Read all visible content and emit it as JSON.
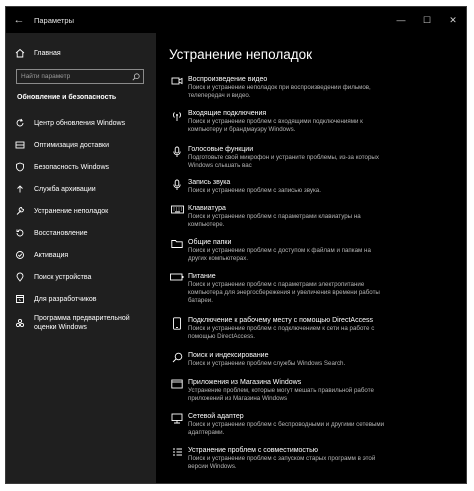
{
  "window": {
    "title": "Параметры",
    "back_icon": "←",
    "minimize_icon": "—",
    "maximize_icon": "☐",
    "close_icon": "✕"
  },
  "sidebar": {
    "home_label": "Главная",
    "search_placeholder": "Найти параметр",
    "section_label": "Обновление и безопасность",
    "items": [
      {
        "label": "Центр обновления Windows",
        "icon": "refresh-icon"
      },
      {
        "label": "Оптимизация доставки",
        "icon": "delivery-icon"
      },
      {
        "label": "Безопасность Windows",
        "icon": "shield-icon"
      },
      {
        "label": "Служба архивации",
        "icon": "backup-icon"
      },
      {
        "label": "Устранение неполадок",
        "icon": "wrench-icon"
      },
      {
        "label": "Восстановление",
        "icon": "recovery-icon"
      },
      {
        "label": "Активация",
        "icon": "activation-icon"
      },
      {
        "label": "Поиск устройства",
        "icon": "find-device-icon"
      },
      {
        "label": "Для разработчиков",
        "icon": "developer-icon"
      },
      {
        "label": "Программа предварительной оценки Windows",
        "icon": "insider-icon"
      }
    ]
  },
  "main": {
    "title": "Устранение неполадок",
    "items": [
      {
        "title": "Воспроизведение видео",
        "desc": "Поиск и устранение неполадок при воспроизведении фильмов, телепередач и видео.",
        "icon": "video-icon"
      },
      {
        "title": "Входящие подключения",
        "desc": "Поиск и устранение проблем с входящими подключениями к компьютеру и брандмауэру Windows.",
        "icon": "antenna-icon"
      },
      {
        "title": "Голосовые функции",
        "desc": "Подготовьте свой микрофон и устраните проблемы, из-за которых Windows слышать вас",
        "icon": "microphone-icon"
      },
      {
        "title": "Запись звука",
        "desc": "Поиск и устранение проблем с записью звука.",
        "icon": "microphone-icon"
      },
      {
        "title": "Клавиатура",
        "desc": "Поиск и устранение проблем с параметрами клавиатуры на компьютере.",
        "icon": "keyboard-icon"
      },
      {
        "title": "Общие папки",
        "desc": "Поиск и устранение проблем с доступом к файлам и папкам на других компьютерах.",
        "icon": "shared-folder-icon"
      },
      {
        "title": "Питание",
        "desc": "Поиск и устранение проблем с параметрами электропитание компьютера для энергосбережения и увеличения времени работы батареи.",
        "icon": "battery-icon"
      },
      {
        "title": "Подключение к рабочему месту с помощью DirectAccess",
        "desc": "Поиск и устранение проблем с подключением к сети на работе с помощью DirectAccess.",
        "icon": "device-phone-icon"
      },
      {
        "title": "Поиск и индексирование",
        "desc": "Поиск и устранение проблем службы Windows Search.",
        "icon": "search-icon"
      },
      {
        "title": "Приложения из Магазина Windows",
        "desc": "Устранение проблем, которые могут мешать правильной работе приложений из Магазина Windows",
        "icon": "store-app-icon"
      },
      {
        "title": "Сетевой адаптер",
        "desc": "Поиск и устранение проблем с беспроводными и другими сетевыми адаптерами.",
        "icon": "network-adapter-icon"
      },
      {
        "title": "Устранение проблем с совместимостью",
        "desc": "Поиск и устранение проблем с запуском старых программ в этой версии Windows.",
        "icon": "compatibility-icon"
      }
    ]
  }
}
